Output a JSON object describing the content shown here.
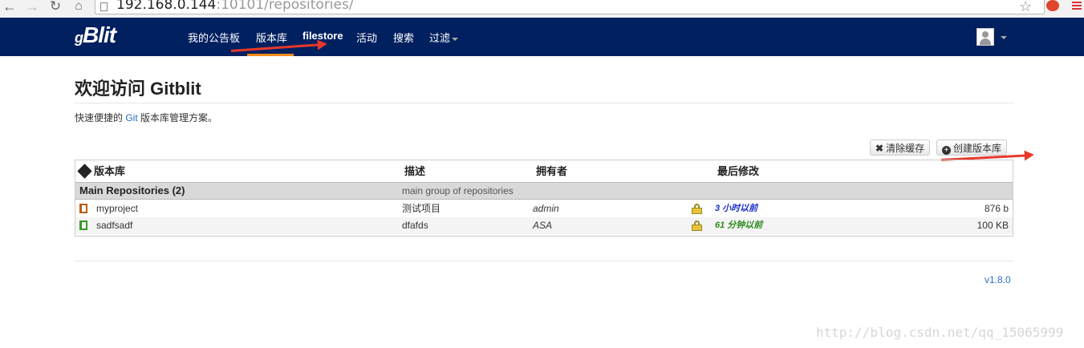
{
  "browser": {
    "back_icon": "arrow-left-icon",
    "forward_icon": "arrow-right-icon",
    "reload_icon": "reload-icon",
    "home_icon": "home-icon",
    "url_host": "192.168.0.144",
    "url_rest": ":10101/repositories/",
    "star_icon": "star-icon",
    "menu_icon": "hamburger-icon"
  },
  "navbar": {
    "brand": "Blit",
    "brand_prefix": "g",
    "items": [
      {
        "label": "我的公告板"
      },
      {
        "label": "版本库"
      },
      {
        "label": "filestore"
      },
      {
        "label": "活动"
      },
      {
        "label": "搜索"
      },
      {
        "label": "过滤"
      }
    ],
    "active_item": "版本库",
    "colors": {
      "background": "#002060",
      "active_indicator": "#f28a1a"
    }
  },
  "page": {
    "title": "欢迎访问 Gitblit",
    "tagline_before": "快速便捷的 ",
    "tagline_link": "Git",
    "tagline_after": " 版本库管理方案。"
  },
  "actions": {
    "clear_cache": "清除缓存",
    "create_repo": "创建版本库"
  },
  "table": {
    "headers": {
      "repository": "版本库",
      "description": "描述",
      "owner": "拥有者",
      "last_change": "最后修改"
    },
    "group": {
      "name": "Main Repositories (2)",
      "description": "main group of repositories"
    },
    "rows": [
      {
        "name": "myproject",
        "description": "测试项目",
        "owner": "admin",
        "last_change": "3 小时以前",
        "size": "876 b",
        "change_color": "#1a2fc8"
      },
      {
        "name": "sadfsadf",
        "description": "dfafds",
        "owner": "ASA",
        "last_change": "61 分钟以前",
        "size": "100 KB",
        "change_color": "#2e8b1e"
      }
    ]
  },
  "footer": {
    "version": "v1.8.0"
  },
  "watermark": "http://blog.csdn.net/qq_15065999"
}
